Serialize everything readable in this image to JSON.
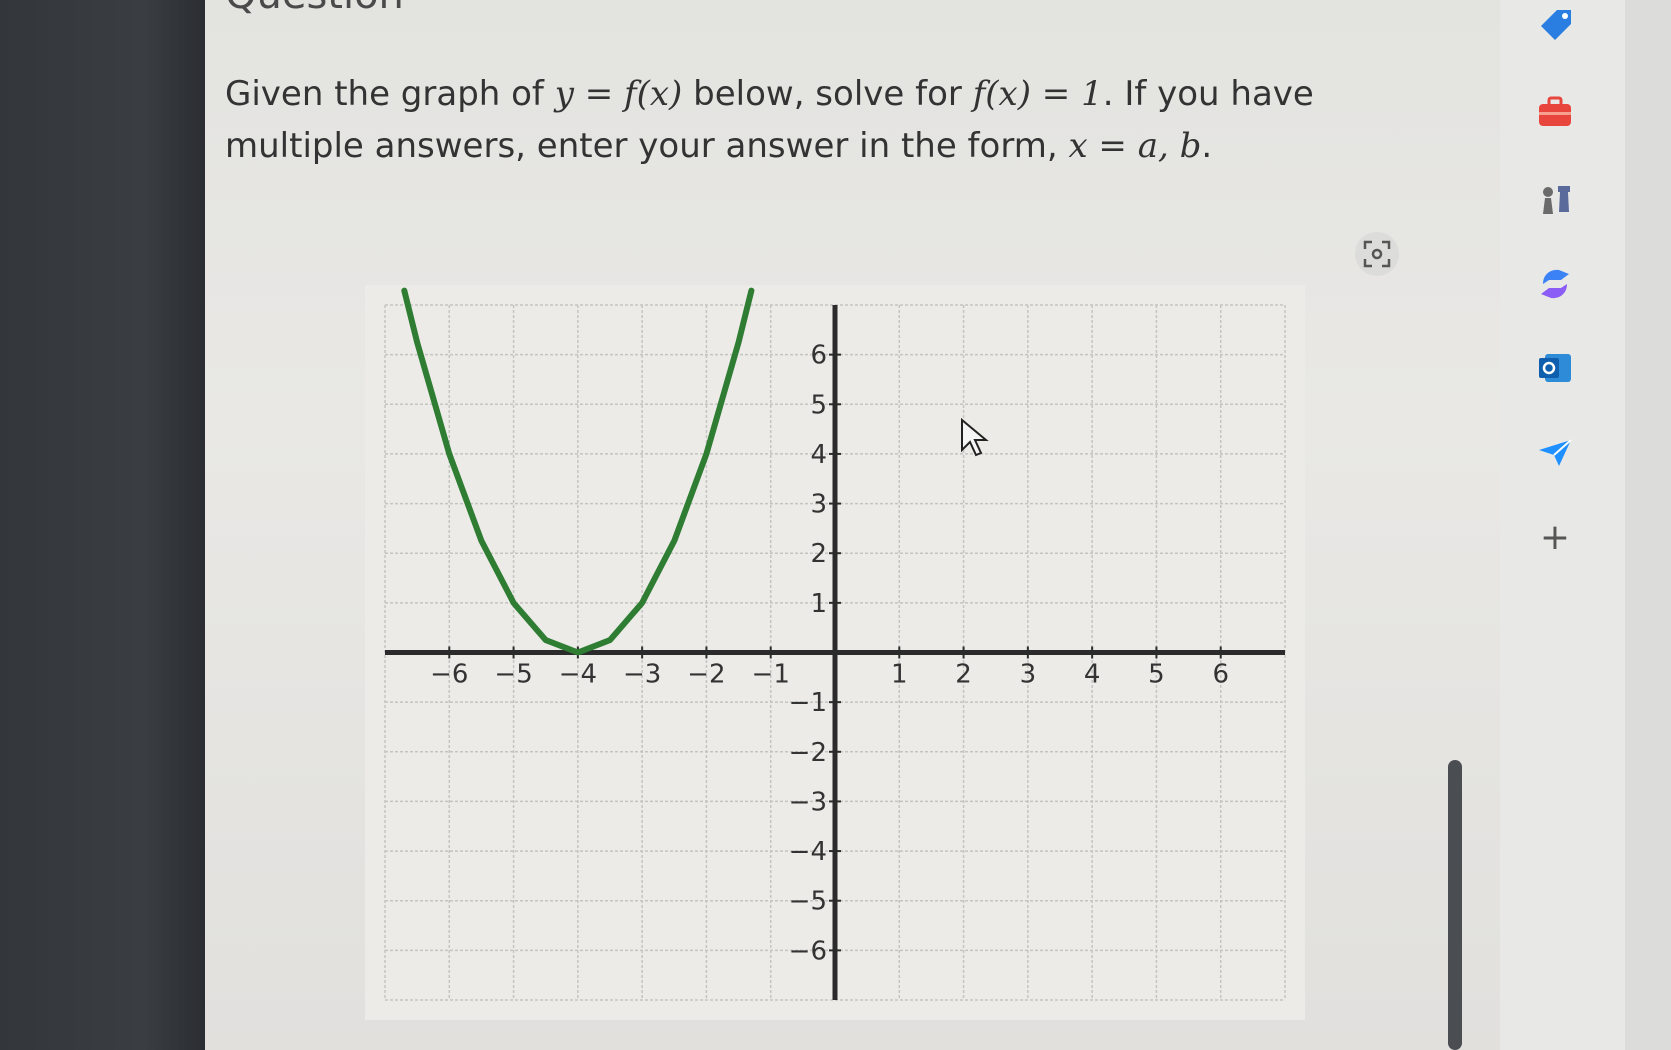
{
  "page": {
    "heading": "Question",
    "question": {
      "part1": "Given the graph of ",
      "math1": "y = f(x)",
      "part2": " below, solve for ",
      "math2": "f(x) = 1",
      "part3": ". If you have multiple answers, enter your answer in the form, ",
      "math3": "x = a, b",
      "part4": "."
    }
  },
  "chart_data": {
    "type": "line",
    "title": "",
    "xlabel": "",
    "ylabel": "",
    "xlim": [
      -7,
      7
    ],
    "ylim": [
      -7,
      7
    ],
    "xticks": [
      -6,
      -5,
      -4,
      -3,
      -2,
      -1,
      1,
      2,
      3,
      4,
      5,
      6
    ],
    "yticks": [
      -6,
      -5,
      -4,
      -3,
      -2,
      -1,
      1,
      2,
      3,
      4,
      5,
      6
    ],
    "grid": true,
    "series": [
      {
        "color": "#2e7d32",
        "x": [
          -6.7,
          -6.5,
          -6,
          -5.5,
          -5,
          -4.5,
          -4,
          -3.5,
          -3,
          -2.5,
          -2,
          -1.5,
          -1.3
        ],
        "y": [
          7.29,
          6.25,
          4,
          2.25,
          1,
          0.25,
          0,
          0.25,
          1,
          2.25,
          4,
          6.25,
          7.29
        ]
      }
    ]
  },
  "sidebar": {
    "icons": [
      "tag-icon",
      "briefcase-icon",
      "chess-icon",
      "copilot-icon",
      "outlook-icon",
      "send-icon",
      "plus-icon"
    ],
    "plus_label": "+"
  }
}
